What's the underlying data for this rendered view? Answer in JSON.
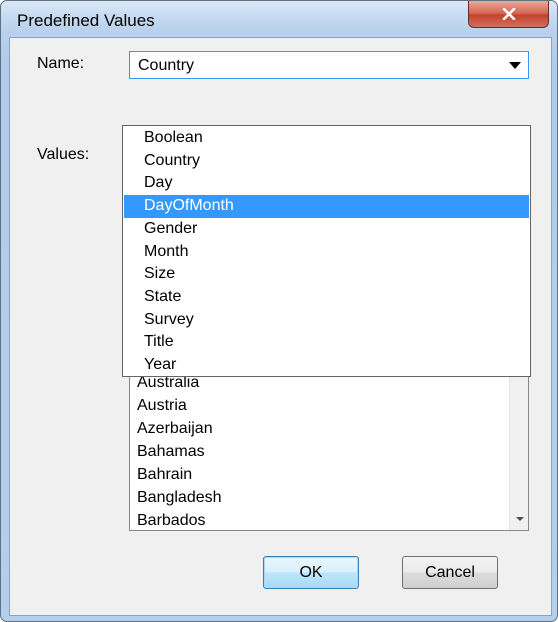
{
  "window": {
    "title": "Predefined Values",
    "close_glyph": "X"
  },
  "form": {
    "name_label": "Name:",
    "values_label": "Values:",
    "name_combo": {
      "value": "Country",
      "options": [
        "Boolean",
        "Country",
        "Day",
        "DayOfMonth",
        "Gender",
        "Month",
        "Size",
        "State",
        "Survey",
        "Title",
        "Year"
      ],
      "highlighted": "DayOfMonth"
    },
    "values_list": {
      "visible_items": [
        "Australia",
        "Austria",
        "Azerbaijan",
        "Bahamas",
        "Bahrain",
        "Bangladesh",
        "Barbados"
      ]
    }
  },
  "buttons": {
    "ok": "OK",
    "cancel": "Cancel"
  },
  "colors": {
    "selection": "#3399ff",
    "title_close": "#c4432c",
    "window_frame": "#b9d1ec"
  }
}
